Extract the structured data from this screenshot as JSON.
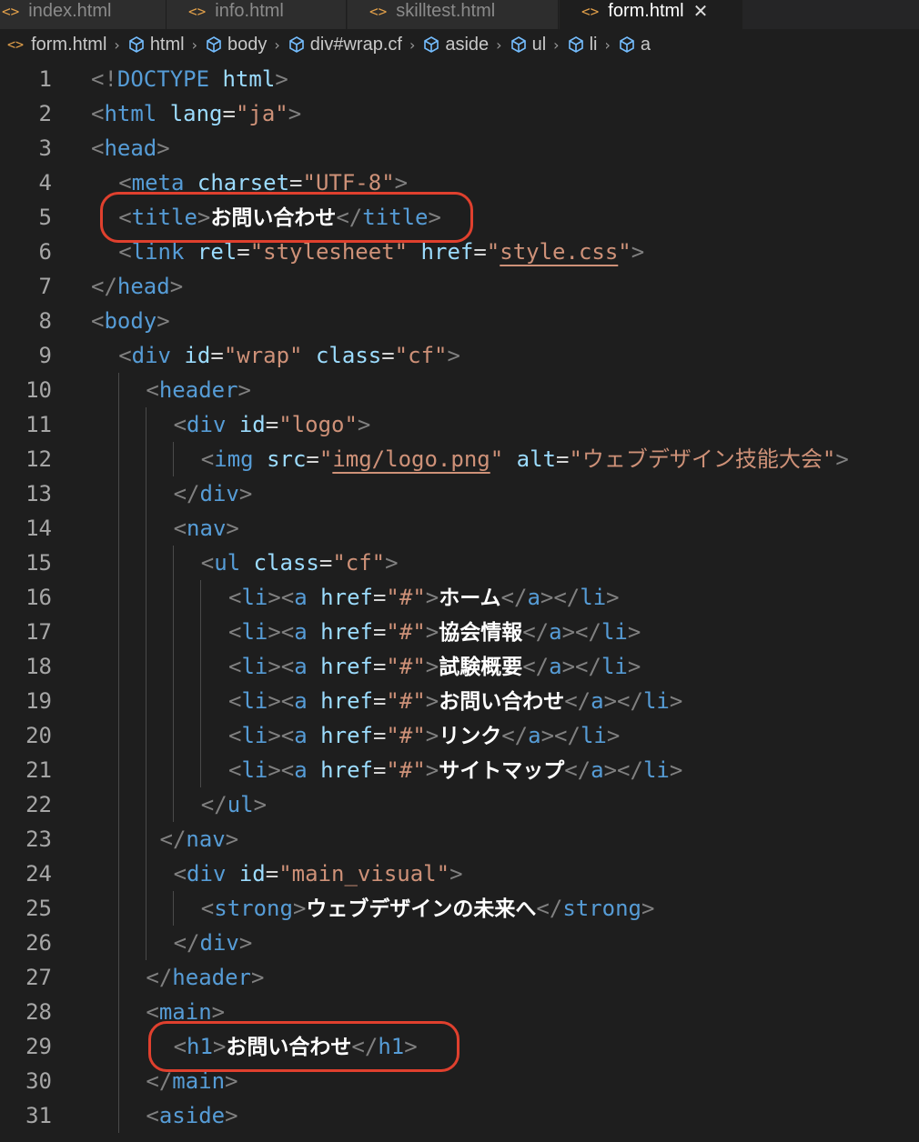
{
  "tabs": [
    {
      "label": "index.html",
      "icon": "html-file-icon",
      "active": false
    },
    {
      "label": "info.html",
      "icon": "html-file-icon",
      "active": false
    },
    {
      "label": "skilltest.html",
      "icon": "html-file-icon",
      "active": false
    },
    {
      "label": "form.html",
      "icon": "html-file-icon",
      "active": true,
      "close": "✕"
    }
  ],
  "breadcrumb": {
    "file": "form.html",
    "items": [
      "html",
      "body",
      "div#wrap.cf",
      "aside",
      "ul",
      "li",
      "a"
    ]
  },
  "code_lines": [
    {
      "num": "1",
      "tokens": [
        {
          "t": "<!",
          "c": "punct"
        },
        {
          "t": "DOCTYPE",
          "c": "tag"
        },
        {
          "t": " "
        },
        {
          "t": "html",
          "c": "attr"
        },
        {
          "t": ">",
          "c": "punct"
        }
      ]
    },
    {
      "num": "2",
      "tokens": [
        {
          "t": "<",
          "c": "punct"
        },
        {
          "t": "html",
          "c": "tag"
        },
        {
          "t": " "
        },
        {
          "t": "lang",
          "c": "attr"
        },
        {
          "t": "=",
          "c": "eq"
        },
        {
          "t": "\"ja\"",
          "c": "str"
        },
        {
          "t": ">",
          "c": "punct"
        }
      ]
    },
    {
      "num": "3",
      "tokens": [
        {
          "t": "<",
          "c": "punct"
        },
        {
          "t": "head",
          "c": "tag"
        },
        {
          "t": ">",
          "c": "punct"
        }
      ]
    },
    {
      "num": "4",
      "tokens": [
        {
          "t": "<",
          "c": "punct"
        },
        {
          "t": "meta",
          "c": "tag"
        },
        {
          "t": " "
        },
        {
          "t": "charset",
          "c": "attr"
        },
        {
          "t": "=",
          "c": "eq"
        },
        {
          "t": "\"UTF-8\"",
          "c": "str"
        },
        {
          "t": ">",
          "c": "punct"
        }
      ]
    },
    {
      "num": "5",
      "tokens": [
        {
          "t": "<",
          "c": "punct"
        },
        {
          "t": "title",
          "c": "tag"
        },
        {
          "t": ">",
          "c": "punct"
        },
        {
          "t": "お問い合わせ",
          "c": "text"
        },
        {
          "t": "</",
          "c": "punct"
        },
        {
          "t": "title",
          "c": "tag"
        },
        {
          "t": ">",
          "c": "punct"
        }
      ]
    },
    {
      "num": "6",
      "tokens": [
        {
          "t": "<",
          "c": "punct"
        },
        {
          "t": "link",
          "c": "tag"
        },
        {
          "t": " "
        },
        {
          "t": "rel",
          "c": "attr"
        },
        {
          "t": "=",
          "c": "eq"
        },
        {
          "t": "\"stylesheet\"",
          "c": "str"
        },
        {
          "t": " "
        },
        {
          "t": "href",
          "c": "attr"
        },
        {
          "t": "=",
          "c": "eq"
        },
        {
          "t": "\"",
          "c": "str"
        },
        {
          "t": "style.css",
          "c": "str",
          "link": true
        },
        {
          "t": "\"",
          "c": "str"
        },
        {
          "t": ">",
          "c": "punct"
        }
      ]
    },
    {
      "num": "7",
      "tokens": [
        {
          "t": "</",
          "c": "punct"
        },
        {
          "t": "head",
          "c": "tag"
        },
        {
          "t": ">",
          "c": "punct"
        }
      ]
    },
    {
      "num": "8",
      "tokens": [
        {
          "t": "<",
          "c": "punct"
        },
        {
          "t": "body",
          "c": "tag"
        },
        {
          "t": ">",
          "c": "punct"
        }
      ]
    },
    {
      "num": "9",
      "tokens": [
        {
          "t": "<",
          "c": "punct"
        },
        {
          "t": "div",
          "c": "tag"
        },
        {
          "t": " "
        },
        {
          "t": "id",
          "c": "attr"
        },
        {
          "t": "=",
          "c": "eq"
        },
        {
          "t": "\"wrap\"",
          "c": "str"
        },
        {
          "t": " "
        },
        {
          "t": "class",
          "c": "attr"
        },
        {
          "t": "=",
          "c": "eq"
        },
        {
          "t": "\"cf\"",
          "c": "str"
        },
        {
          "t": ">",
          "c": "punct"
        }
      ]
    },
    {
      "num": "10",
      "tokens": [
        {
          "t": "<",
          "c": "punct"
        },
        {
          "t": "header",
          "c": "tag"
        },
        {
          "t": ">",
          "c": "punct"
        }
      ]
    },
    {
      "num": "11",
      "tokens": [
        {
          "t": "<",
          "c": "punct"
        },
        {
          "t": "div",
          "c": "tag"
        },
        {
          "t": " "
        },
        {
          "t": "id",
          "c": "attr"
        },
        {
          "t": "=",
          "c": "eq"
        },
        {
          "t": "\"logo\"",
          "c": "str"
        },
        {
          "t": ">",
          "c": "punct"
        }
      ]
    },
    {
      "num": "12",
      "tokens": [
        {
          "t": "<",
          "c": "punct"
        },
        {
          "t": "img",
          "c": "tag"
        },
        {
          "t": " "
        },
        {
          "t": "src",
          "c": "attr"
        },
        {
          "t": "=",
          "c": "eq"
        },
        {
          "t": "\"",
          "c": "str"
        },
        {
          "t": "img/logo.png",
          "c": "str",
          "link": true
        },
        {
          "t": "\"",
          "c": "str"
        },
        {
          "t": " "
        },
        {
          "t": "alt",
          "c": "attr"
        },
        {
          "t": "=",
          "c": "eq"
        },
        {
          "t": "\"ウェブデザイン技能大会\"",
          "c": "str"
        },
        {
          "t": ">",
          "c": "punct"
        }
      ]
    },
    {
      "num": "13",
      "tokens": [
        {
          "t": "</",
          "c": "punct"
        },
        {
          "t": "div",
          "c": "tag"
        },
        {
          "t": ">",
          "c": "punct"
        }
      ]
    },
    {
      "num": "14",
      "tokens": [
        {
          "t": "<",
          "c": "punct"
        },
        {
          "t": "nav",
          "c": "tag"
        },
        {
          "t": ">",
          "c": "punct"
        }
      ]
    },
    {
      "num": "15",
      "tokens": [
        {
          "t": "<",
          "c": "punct"
        },
        {
          "t": "ul",
          "c": "tag"
        },
        {
          "t": " "
        },
        {
          "t": "class",
          "c": "attr"
        },
        {
          "t": "=",
          "c": "eq"
        },
        {
          "t": "\"cf\"",
          "c": "str"
        },
        {
          "t": ">",
          "c": "punct"
        }
      ]
    },
    {
      "num": "16",
      "tokens": [
        {
          "t": "<",
          "c": "punct"
        },
        {
          "t": "li",
          "c": "tag"
        },
        {
          "t": "><",
          "c": "punct"
        },
        {
          "t": "a",
          "c": "tag"
        },
        {
          "t": " "
        },
        {
          "t": "href",
          "c": "attr"
        },
        {
          "t": "=",
          "c": "eq"
        },
        {
          "t": "\"#\"",
          "c": "str"
        },
        {
          "t": ">",
          "c": "punct"
        },
        {
          "t": "ホーム",
          "c": "text"
        },
        {
          "t": "</",
          "c": "punct"
        },
        {
          "t": "a",
          "c": "tag"
        },
        {
          "t": "></",
          "c": "punct"
        },
        {
          "t": "li",
          "c": "tag"
        },
        {
          "t": ">",
          "c": "punct"
        }
      ]
    },
    {
      "num": "17",
      "tokens": [
        {
          "t": "<",
          "c": "punct"
        },
        {
          "t": "li",
          "c": "tag"
        },
        {
          "t": "><",
          "c": "punct"
        },
        {
          "t": "a",
          "c": "tag"
        },
        {
          "t": " "
        },
        {
          "t": "href",
          "c": "attr"
        },
        {
          "t": "=",
          "c": "eq"
        },
        {
          "t": "\"#\"",
          "c": "str"
        },
        {
          "t": ">",
          "c": "punct"
        },
        {
          "t": "協会情報",
          "c": "text"
        },
        {
          "t": "</",
          "c": "punct"
        },
        {
          "t": "a",
          "c": "tag"
        },
        {
          "t": "></",
          "c": "punct"
        },
        {
          "t": "li",
          "c": "tag"
        },
        {
          "t": ">",
          "c": "punct"
        }
      ]
    },
    {
      "num": "18",
      "tokens": [
        {
          "t": "<",
          "c": "punct"
        },
        {
          "t": "li",
          "c": "tag"
        },
        {
          "t": "><",
          "c": "punct"
        },
        {
          "t": "a",
          "c": "tag"
        },
        {
          "t": " "
        },
        {
          "t": "href",
          "c": "attr"
        },
        {
          "t": "=",
          "c": "eq"
        },
        {
          "t": "\"#\"",
          "c": "str"
        },
        {
          "t": ">",
          "c": "punct"
        },
        {
          "t": "試験概要",
          "c": "text"
        },
        {
          "t": "</",
          "c": "punct"
        },
        {
          "t": "a",
          "c": "tag"
        },
        {
          "t": "></",
          "c": "punct"
        },
        {
          "t": "li",
          "c": "tag"
        },
        {
          "t": ">",
          "c": "punct"
        }
      ]
    },
    {
      "num": "19",
      "tokens": [
        {
          "t": "<",
          "c": "punct"
        },
        {
          "t": "li",
          "c": "tag"
        },
        {
          "t": "><",
          "c": "punct"
        },
        {
          "t": "a",
          "c": "tag"
        },
        {
          "t": " "
        },
        {
          "t": "href",
          "c": "attr"
        },
        {
          "t": "=",
          "c": "eq"
        },
        {
          "t": "\"#\"",
          "c": "str"
        },
        {
          "t": ">",
          "c": "punct"
        },
        {
          "t": "お問い合わせ",
          "c": "text"
        },
        {
          "t": "</",
          "c": "punct"
        },
        {
          "t": "a",
          "c": "tag"
        },
        {
          "t": "></",
          "c": "punct"
        },
        {
          "t": "li",
          "c": "tag"
        },
        {
          "t": ">",
          "c": "punct"
        }
      ]
    },
    {
      "num": "20",
      "tokens": [
        {
          "t": "<",
          "c": "punct"
        },
        {
          "t": "li",
          "c": "tag"
        },
        {
          "t": "><",
          "c": "punct"
        },
        {
          "t": "a",
          "c": "tag"
        },
        {
          "t": " "
        },
        {
          "t": "href",
          "c": "attr"
        },
        {
          "t": "=",
          "c": "eq"
        },
        {
          "t": "\"#\"",
          "c": "str"
        },
        {
          "t": ">",
          "c": "punct"
        },
        {
          "t": "リンク",
          "c": "text"
        },
        {
          "t": "</",
          "c": "punct"
        },
        {
          "t": "a",
          "c": "tag"
        },
        {
          "t": "></",
          "c": "punct"
        },
        {
          "t": "li",
          "c": "tag"
        },
        {
          "t": ">",
          "c": "punct"
        }
      ]
    },
    {
      "num": "21",
      "tokens": [
        {
          "t": "<",
          "c": "punct"
        },
        {
          "t": "li",
          "c": "tag"
        },
        {
          "t": "><",
          "c": "punct"
        },
        {
          "t": "a",
          "c": "tag"
        },
        {
          "t": " "
        },
        {
          "t": "href",
          "c": "attr"
        },
        {
          "t": "=",
          "c": "eq"
        },
        {
          "t": "\"#\"",
          "c": "str"
        },
        {
          "t": ">",
          "c": "punct"
        },
        {
          "t": "サイトマップ",
          "c": "text"
        },
        {
          "t": "</",
          "c": "punct"
        },
        {
          "t": "a",
          "c": "tag"
        },
        {
          "t": "></",
          "c": "punct"
        },
        {
          "t": "li",
          "c": "tag"
        },
        {
          "t": ">",
          "c": "punct"
        }
      ]
    },
    {
      "num": "22",
      "tokens": [
        {
          "t": "</",
          "c": "punct"
        },
        {
          "t": "ul",
          "c": "tag"
        },
        {
          "t": ">",
          "c": "punct"
        }
      ]
    },
    {
      "num": "23",
      "tokens": [
        {
          "t": "</",
          "c": "punct"
        },
        {
          "t": "nav",
          "c": "tag"
        },
        {
          "t": ">",
          "c": "punct"
        }
      ]
    },
    {
      "num": "24",
      "tokens": [
        {
          "t": "<",
          "c": "punct"
        },
        {
          "t": "div",
          "c": "tag"
        },
        {
          "t": " "
        },
        {
          "t": "id",
          "c": "attr"
        },
        {
          "t": "=",
          "c": "eq"
        },
        {
          "t": "\"main_visual\"",
          "c": "str"
        },
        {
          "t": ">",
          "c": "punct"
        }
      ]
    },
    {
      "num": "25",
      "tokens": [
        {
          "t": "<",
          "c": "punct"
        },
        {
          "t": "strong",
          "c": "tag"
        },
        {
          "t": ">",
          "c": "punct"
        },
        {
          "t": "ウェブデザインの未来へ",
          "c": "text"
        },
        {
          "t": "</",
          "c": "punct"
        },
        {
          "t": "strong",
          "c": "tag"
        },
        {
          "t": ">",
          "c": "punct"
        }
      ]
    },
    {
      "num": "26",
      "tokens": [
        {
          "t": "</",
          "c": "punct"
        },
        {
          "t": "div",
          "c": "tag"
        },
        {
          "t": ">",
          "c": "punct"
        }
      ]
    },
    {
      "num": "27",
      "tokens": [
        {
          "t": "</",
          "c": "punct"
        },
        {
          "t": "header",
          "c": "tag"
        },
        {
          "t": ">",
          "c": "punct"
        }
      ]
    },
    {
      "num": "28",
      "tokens": [
        {
          "t": "<",
          "c": "punct"
        },
        {
          "t": "main",
          "c": "tag"
        },
        {
          "t": ">",
          "c": "punct"
        }
      ]
    },
    {
      "num": "29",
      "tokens": [
        {
          "t": "<",
          "c": "punct"
        },
        {
          "t": "h1",
          "c": "tag"
        },
        {
          "t": ">",
          "c": "punct"
        },
        {
          "t": "お問い合わせ",
          "c": "text"
        },
        {
          "t": "</",
          "c": "punct"
        },
        {
          "t": "h1",
          "c": "tag"
        },
        {
          "t": ">",
          "c": "punct"
        }
      ]
    },
    {
      "num": "30",
      "tokens": [
        {
          "t": "</",
          "c": "punct"
        },
        {
          "t": "main",
          "c": "tag"
        },
        {
          "t": ">",
          "c": "punct"
        }
      ]
    },
    {
      "num": "31",
      "tokens": [
        {
          "t": "<",
          "c": "punct"
        },
        {
          "t": "aside",
          "c": "tag"
        },
        {
          "t": ">",
          "c": "punct"
        }
      ]
    }
  ],
  "colors": {
    "background": "#1e1e1e",
    "tag": "#569cd6",
    "attribute": "#9cdcfe",
    "string": "#ce9178",
    "punctuation": "#808080",
    "text": "#ffffff",
    "line_number": "#a6a6a6",
    "highlight_outline": "#e0402e",
    "file_icon": "#e2a04a"
  }
}
